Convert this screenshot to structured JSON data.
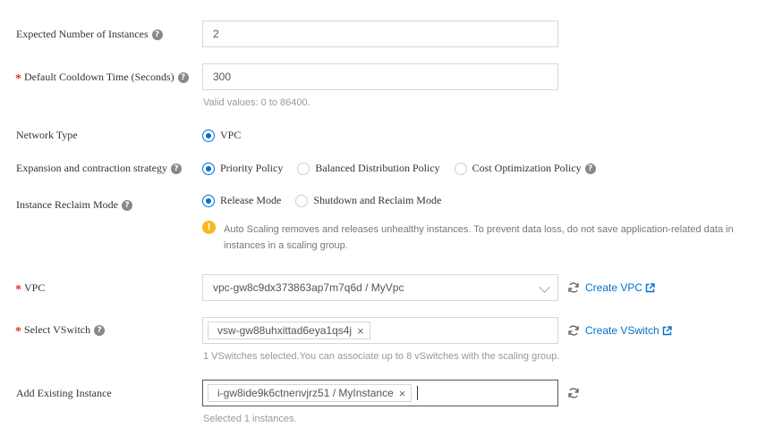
{
  "expected_instances": {
    "label": "Expected Number of Instances",
    "value": "2"
  },
  "cooldown": {
    "required": "*",
    "label": "Default Cooldown Time (Seconds)",
    "value": "300",
    "hint": "Valid values: 0 to 86400."
  },
  "network_type": {
    "label": "Network Type",
    "options": [
      "VPC"
    ],
    "selected": "VPC"
  },
  "strategy": {
    "label": "Expansion and contraction strategy",
    "options": [
      "Priority Policy",
      "Balanced Distribution Policy",
      "Cost Optimization Policy"
    ],
    "selected": "Priority Policy"
  },
  "reclaim": {
    "label": "Instance Reclaim Mode",
    "options": [
      "Release Mode",
      "Shutdown and Reclaim Mode"
    ],
    "selected": "Release Mode",
    "warning": "Auto Scaling removes and releases unhealthy instances. To prevent data loss, do not save application-related data in instances in a scaling group."
  },
  "vpc": {
    "required": "*",
    "label": "VPC",
    "value": "vpc-gw8c9dx373863ap7m7q6d / MyVpc",
    "create_link": "Create VPC"
  },
  "vswitch": {
    "required": "*",
    "label": "Select VSwitch",
    "tag": "vsw-gw88uhxittad6eya1qs4j",
    "tag_remove": "×",
    "hint": "1 VSwitches selected.You can associate up to 8 vSwitches with the scaling group.",
    "create_link": "Create VSwitch"
  },
  "existing_instance": {
    "label": "Add Existing Instance",
    "tag": "i-gw8ide9k6ctnenvjrz51 / MyInstance",
    "tag_remove": "×",
    "hint": "Selected 1 instances."
  },
  "icons": {
    "question": "?",
    "warning": "!"
  },
  "colors": {
    "accent": "#0070cc",
    "required": "#e0332e",
    "warning": "#f8b91e"
  }
}
